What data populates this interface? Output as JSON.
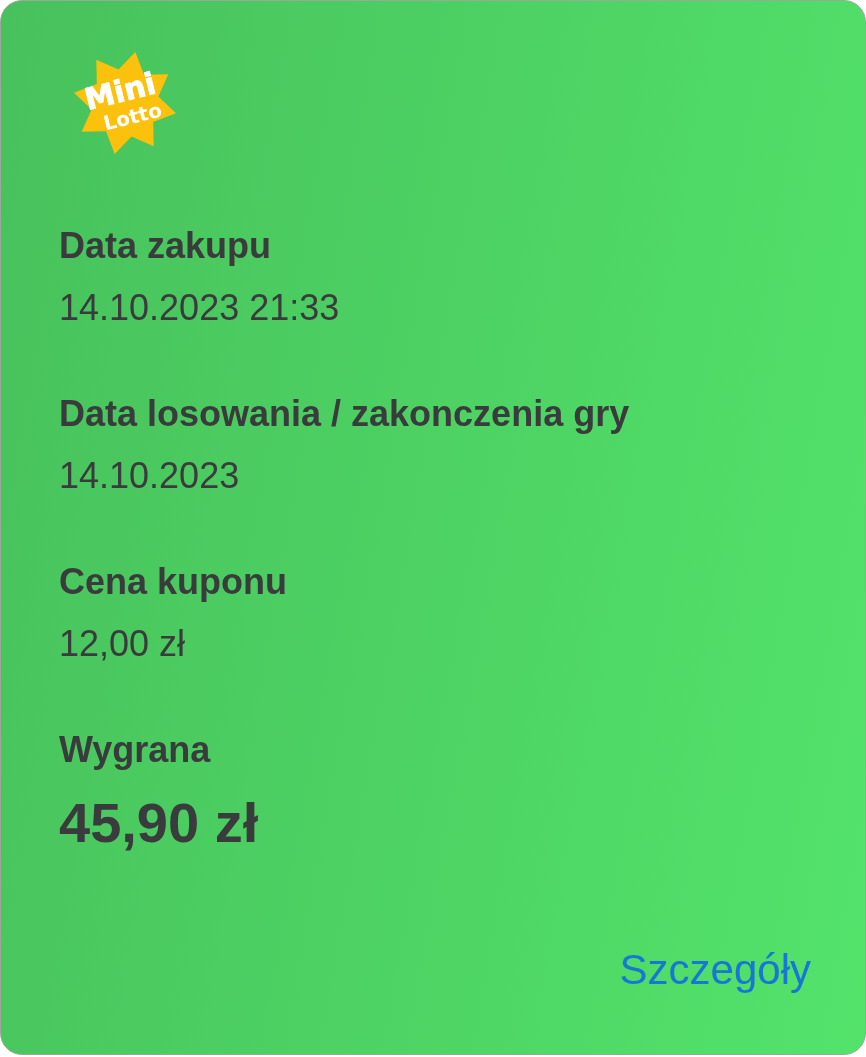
{
  "logo": {
    "line1": "Mini",
    "line2": "Lotto"
  },
  "fields": [
    {
      "label": "Data zakupu",
      "value": "14.10.2023 21:33",
      "kind": "plain"
    },
    {
      "label": "Data losowania / zakonczenia gry",
      "value": "14.10.2023",
      "kind": "plain"
    },
    {
      "label": "Cena kuponu",
      "value": "12,00 zł",
      "kind": "plain"
    },
    {
      "label": "Wygrana",
      "value": "45,90 zł",
      "kind": "prize"
    }
  ],
  "details_link": "Szczegóły"
}
